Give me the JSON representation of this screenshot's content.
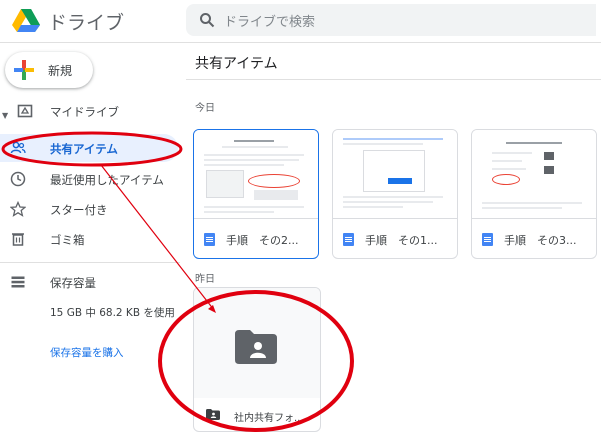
{
  "header": {
    "app_title": "ドライブ",
    "search_placeholder": "ドライブで検索"
  },
  "sidebar": {
    "new_label": "新規",
    "items": [
      {
        "label": "マイドライブ",
        "icon": "drive-icon"
      },
      {
        "label": "共有アイテム",
        "icon": "shared-people-icon"
      },
      {
        "label": "最近使用したアイテム",
        "icon": "clock-icon"
      },
      {
        "label": "スター付き",
        "icon": "star-icon"
      },
      {
        "label": "ゴミ箱",
        "icon": "trash-icon"
      },
      {
        "label": "保存容量",
        "icon": "storage-icon"
      }
    ],
    "storage_text": "15 GB 中 68.2 KB を使用",
    "buy_storage": "保存容量を購入"
  },
  "main": {
    "title": "共有アイテム",
    "sections": [
      {
        "label": "今日",
        "files": [
          {
            "name": "手順　その2..."
          },
          {
            "name": "手順　その1..."
          },
          {
            "name": "手順　その3..."
          }
        ]
      },
      {
        "label": "昨日",
        "folders": [
          {
            "name": "社内共有フォ..."
          }
        ]
      }
    ]
  },
  "colors": {
    "accent": "#1a73e8",
    "selected_bg": "#e8f0fe",
    "annotation": "#e0000f"
  }
}
